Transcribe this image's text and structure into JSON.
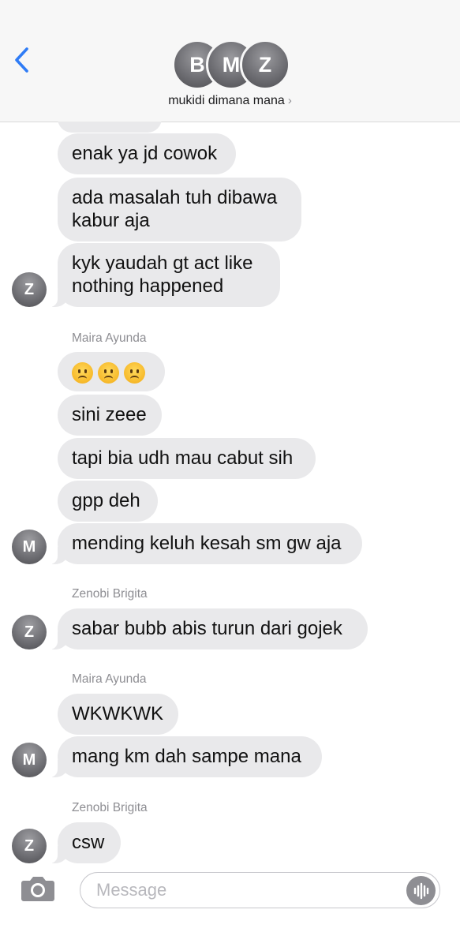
{
  "header": {
    "back_icon": "chevron-left-icon",
    "group_avatars": [
      "B",
      "M",
      "Z"
    ],
    "group_name": "mukidi dimana mana",
    "group_chevron": "›",
    "accent_color": "#2f7cf6"
  },
  "messages": [
    {
      "text": "enak ya jd cowok"
    },
    {
      "text": "ada masalah tuh dibawa"
    },
    {
      "text": "kabur aja"
    },
    {
      "text": "kyk yaudah gt act like"
    },
    {
      "text": "nothing happened"
    },
    {
      "text": "sini zeee"
    },
    {
      "text": "tapi bia udh mau cabut sih"
    },
    {
      "text": "gpp deh"
    },
    {
      "text": "mending keluh kesah sm gw aja"
    },
    {
      "text": "sabar bubb abis turun dari gojek"
    },
    {
      "text": "WKWKWK"
    },
    {
      "text": "mang km dah sampe mana"
    },
    {
      "text": "csw"
    }
  ],
  "emoji_message": [
    "frowning-face-emoji",
    "frowning-face-emoji",
    "frowning-face-emoji"
  ],
  "senders": {
    "maira_1": "Maira Ayunda",
    "zenobi_1": "Zenobi Brigita",
    "maira_2": "Maira Ayunda",
    "zenobi_2": "Zenobi Brigita"
  },
  "avatars": {
    "z1": "Z",
    "m1": "M",
    "z2": "Z",
    "m2": "M",
    "z3": "Z"
  },
  "composer": {
    "placeholder": "Message",
    "value": "",
    "camera_icon": "camera-icon",
    "audio_icon": "waveform-icon"
  },
  "colors": {
    "bubble_gray": "#e9e9eb",
    "avatar_gray": "#6e6e73",
    "sender_gray": "#8e8e93"
  }
}
